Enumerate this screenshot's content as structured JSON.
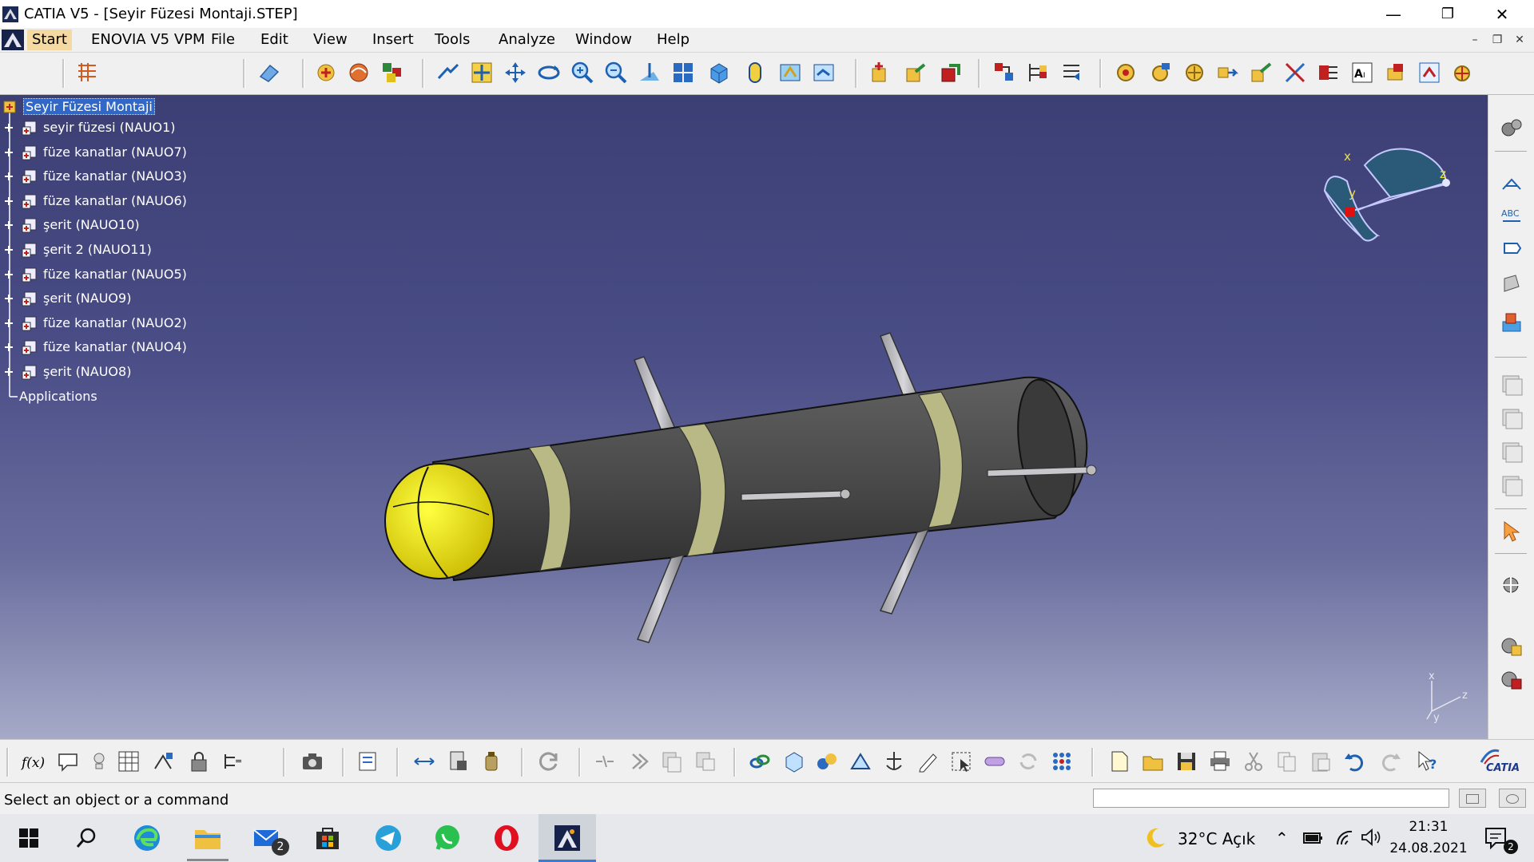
{
  "window": {
    "title": "CATIA V5 - [Seyir Füzesi Montaji.STEP]",
    "controls": [
      "minimize-icon",
      "restore-icon",
      "close-icon"
    ]
  },
  "menu": {
    "items": [
      "Start",
      "ENOVIA V5 VPM",
      "File",
      "Edit",
      "View",
      "Insert",
      "Tools",
      "Analyze",
      "Window",
      "Help"
    ]
  },
  "tree": {
    "root": "Seyir Füzesi Montaji",
    "children": [
      "seyir füzesi (NAUO1)",
      "füze kanatlar (NAUO7)",
      "füze kanatlar (NAUO3)",
      "füze kanatlar (NAUO6)",
      "şerit (NAUO10)",
      "şerit 2 (NAUO11)",
      "füze kanatlar (NAUO5)",
      "şerit (NAUO9)",
      "füze kanatlar (NAUO2)",
      "füze kanatlar (NAUO4)",
      "şerit (NAUO8)"
    ],
    "applications": "Applications"
  },
  "compass": {
    "x": "x",
    "y": "y",
    "z": "z"
  },
  "axis_triad": {
    "x": "x",
    "y": "y",
    "z": "z"
  },
  "status": {
    "message": "Select an object or a command",
    "command_input": ""
  },
  "taskbar": {
    "mail_badge": "2",
    "weather": "32°C  Açık",
    "time": "21:31",
    "date": "24.08.2021"
  },
  "brand": {
    "logo_text": "CATIA"
  },
  "colors": {
    "viewport_top": "#3c3f74",
    "viewport_bottom": "#a6aac8",
    "tree_selection": "#3168c8",
    "missile_body": "#4a4a4a",
    "missile_nose": "#f2e21a",
    "missile_band": "#b9b985",
    "start_highlight": "#f5d9a3"
  }
}
